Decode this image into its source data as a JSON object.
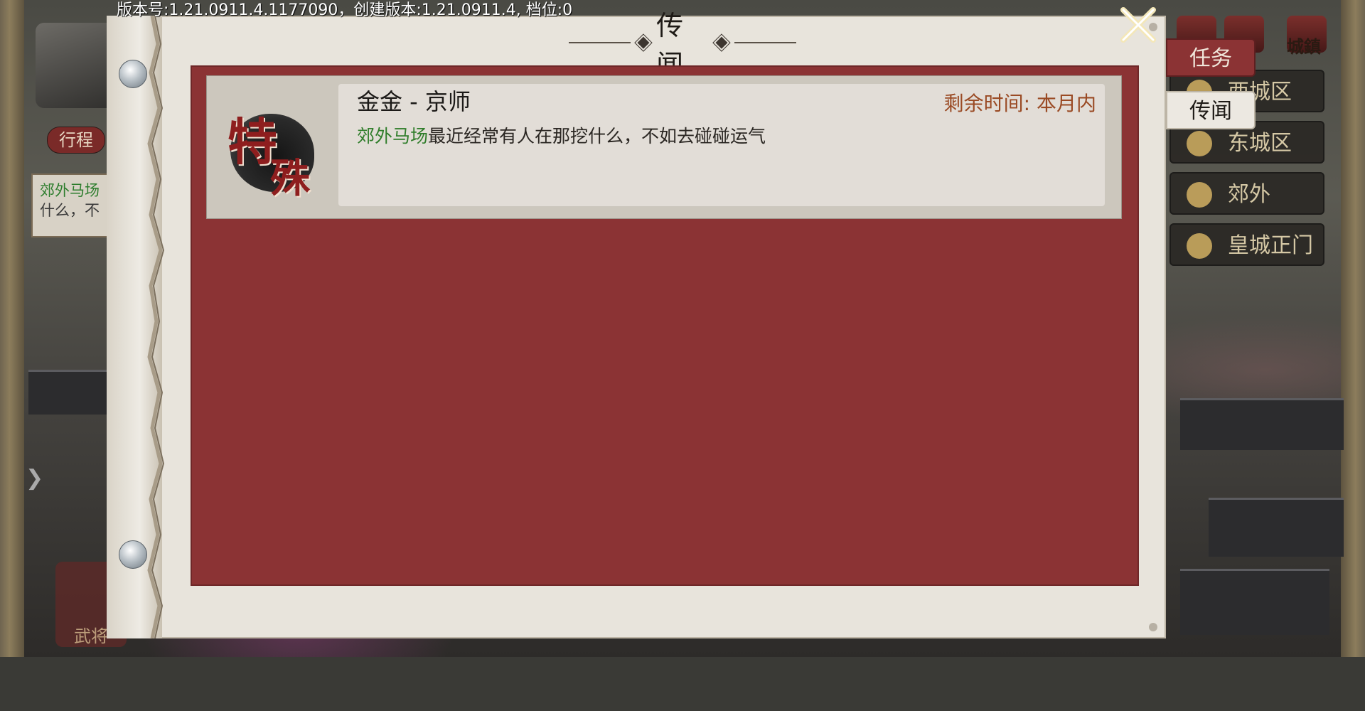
{
  "version_info": "版本号:1.21.0911.4.1177090，创建版本:1.21.0911.4, 档位:0",
  "background": {
    "left_hud": {
      "itinerary_label": "行程",
      "note_line1_green": "郊外马场",
      "note_line2": "什么，不"
    },
    "right_nav": {
      "top_icon_label": "城鎮",
      "items": [
        {
          "label": "西城区",
          "icon": "district-icon"
        },
        {
          "label": "东城区",
          "icon": "pagoda-icon"
        },
        {
          "label": "郊外",
          "icon": "hat-icon"
        },
        {
          "label": "皇城正门",
          "icon": "gate-icon"
        }
      ]
    },
    "bottom_left_label": "武将"
  },
  "panel": {
    "title": "传闻",
    "close_icon": "close-icon",
    "tabs": [
      {
        "label": "任务",
        "active": false
      },
      {
        "label": "传闻",
        "active": true
      }
    ],
    "rumors": [
      {
        "badge_line1": "特",
        "badge_line2": "殊",
        "title": "金金 - 京师",
        "time_label": "剩余时间: 本月内",
        "text_highlight": "郊外马场",
        "text_rest": "最近经常有人在那挖什么，不如去碰碰运气"
      }
    ]
  },
  "colors": {
    "panel_red": "#8b3334",
    "highlight_green": "#2f7d2a",
    "time_orange": "#9a4a24"
  }
}
